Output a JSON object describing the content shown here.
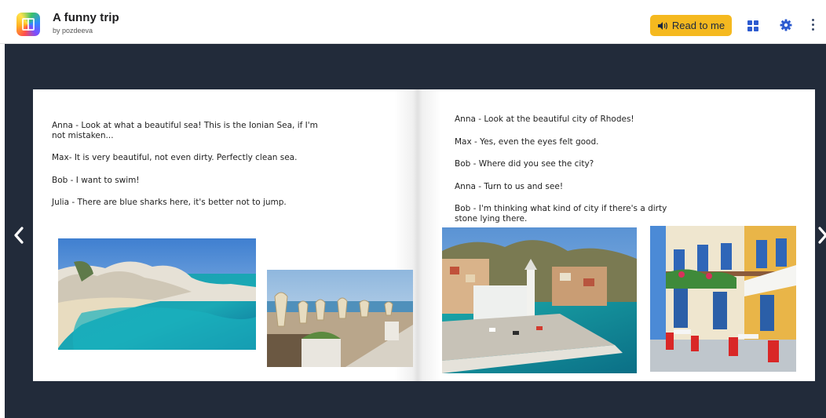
{
  "header": {
    "title": "A funny trip",
    "author": "by pozdeeva",
    "read_button_label": "Read to me",
    "icons": [
      "app-logo",
      "speaker-icon",
      "grid-icon",
      "gear-icon",
      "kebab-menu-icon"
    ]
  },
  "colors": {
    "accent": "#f5b91f",
    "stage": "#222b3a",
    "icon_blue": "#2d5bd0"
  },
  "navigation": {
    "prev_icon": "chevron-left-icon",
    "next_icon": "chevron-right-icon"
  },
  "left_page": {
    "lines": [
      "Anna - Look at what a beautiful sea! This is the Ionian Sea, if I'm not mistaken...",
      "Max- It is very beautiful, not even dirty. Perfectly clean sea.",
      "Bob - I want to swim!",
      "Julia - There are blue sharks here, it's better not to jump."
    ],
    "images": [
      "beach-photo",
      "beach-cafe-photo"
    ]
  },
  "right_page": {
    "lines": [
      "Anna - Look at the beautiful city of Rhodes!",
      "Max - Yes, even the eyes felt good.",
      "Bob - Where did you see the city?",
      "Anna - Turn to us and see!",
      "Bob - I'm thinking what kind of city if there's a dirty stone lying there."
    ],
    "images": [
      "rhodes-harbor-photo",
      "street-cafe-photo"
    ]
  }
}
